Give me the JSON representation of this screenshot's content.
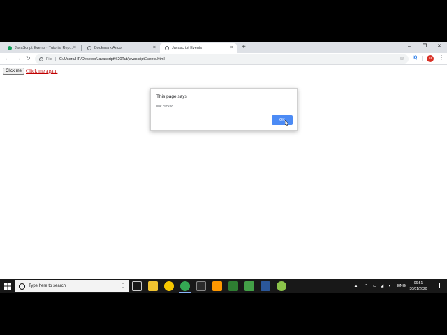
{
  "browser": {
    "tabs": [
      {
        "title": "JavaScript Events - Tutorial Rep...",
        "active": false,
        "favicon_color": "#0f9d58"
      },
      {
        "title": "Bookmark Ancor",
        "active": false,
        "favicon_color": "#5f6368"
      },
      {
        "title": "Javascript Events",
        "active": true,
        "favicon_color": "#5f6368"
      }
    ],
    "new_tab_symbol": "+",
    "window_controls": {
      "minimize": "–",
      "maximize": "❐",
      "close": "✕"
    },
    "tab_close_symbol": "×",
    "address": {
      "scheme_label": "File",
      "url": "C:/Users/HP/Desktop/Javascript%20Tut/javascriptEvents.html"
    },
    "extension_label": "IQ",
    "avatar_label": "U"
  },
  "page": {
    "button_label": "Click me",
    "link_text": "Click me again"
  },
  "dialog": {
    "title": "This page says",
    "message": "link clicked",
    "ok_label": "OK",
    "ok_color": "#4c8bf5"
  },
  "taskbar": {
    "search_placeholder": "Type here to search",
    "apps": [
      {
        "name": "task-view-icon",
        "color": "#3a3a3a"
      },
      {
        "name": "file-explorer-icon",
        "color": "#f0c330"
      },
      {
        "name": "norton-icon",
        "color": "#f6c700"
      },
      {
        "name": "chrome-icon",
        "color": "#34a853"
      },
      {
        "name": "terminal-icon",
        "color": "#2b2b2b"
      },
      {
        "name": "sublime-text-icon",
        "color": "#ff9800"
      },
      {
        "name": "camtasia-icon",
        "color": "#2e7d32"
      },
      {
        "name": "camtasia-recorder-icon",
        "color": "#43a047"
      },
      {
        "name": "word-icon",
        "color": "#2b579a"
      },
      {
        "name": "ccleaner-icon",
        "color": "#8bc34a"
      }
    ],
    "tray": {
      "language": "ENG",
      "time": "06:51",
      "date": "30/01/2020"
    }
  }
}
